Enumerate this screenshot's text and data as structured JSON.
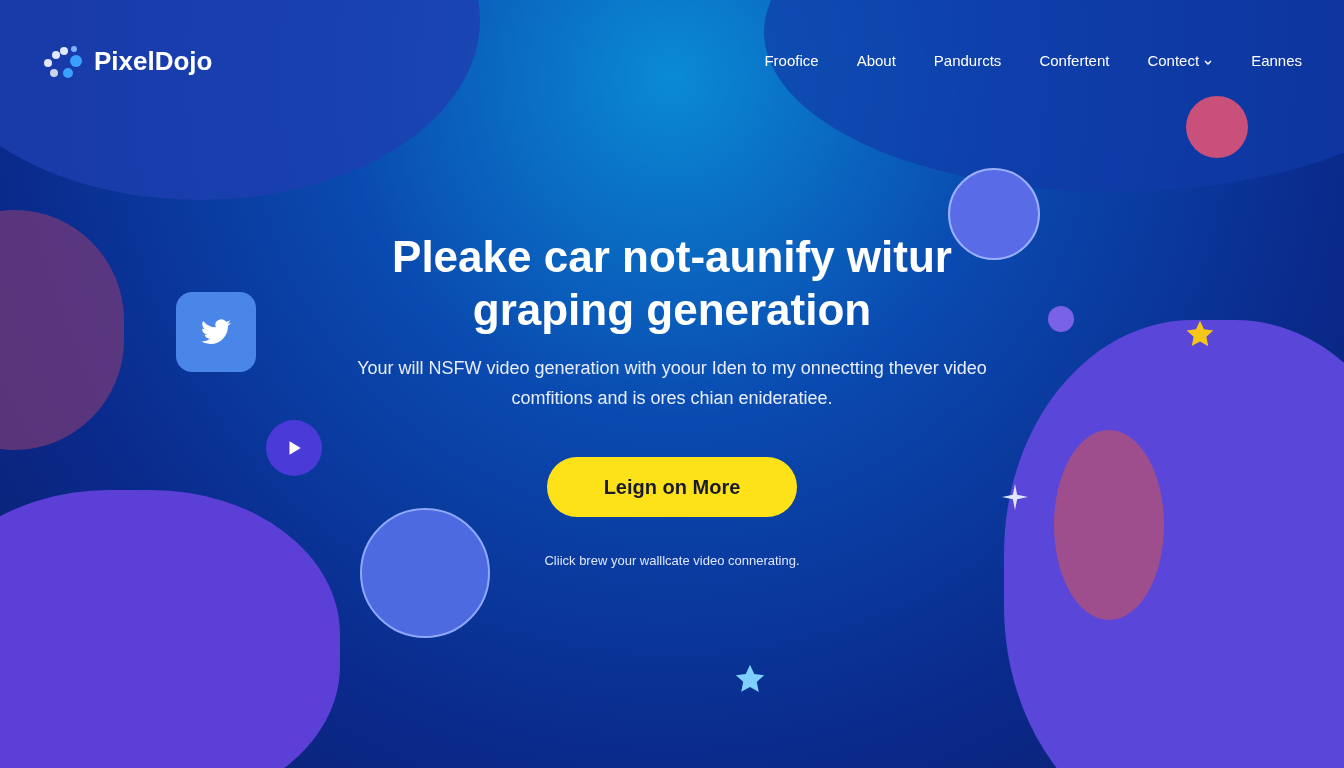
{
  "brand": {
    "name": "PixelDojo"
  },
  "nav": [
    {
      "label": "Froofice",
      "dropdown": false
    },
    {
      "label": "About",
      "dropdown": false
    },
    {
      "label": "Pandurcts",
      "dropdown": false
    },
    {
      "label": "Confertent",
      "dropdown": false
    },
    {
      "label": "Contect",
      "dropdown": true
    },
    {
      "label": "Eannes",
      "dropdown": false
    }
  ],
  "hero": {
    "title_lines": [
      "Pleake car not-aunify witur",
      "graping generation"
    ],
    "subtitle": "Your will NSFW video generation with yoour Iden to my onnectting thever video comfitions and is ores chian enideratiee.",
    "button": "Leign on More",
    "note": "Cliick brew your walllcate video connerating."
  }
}
